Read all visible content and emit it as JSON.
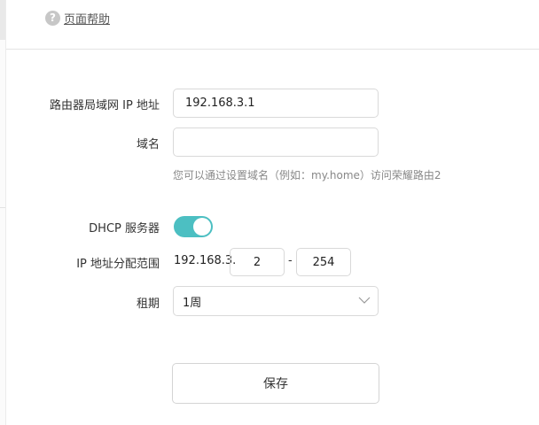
{
  "header": {
    "help_icon": "question-circle-icon",
    "help_label": "页面帮助"
  },
  "form": {
    "lan_ip": {
      "label": "路由器局域网 IP 地址",
      "value": "192.168.3.1"
    },
    "domain": {
      "label": "域名",
      "value": "",
      "hint": "您可以通过设置域名（例如：my.home）访问荣耀路由2"
    },
    "dhcp": {
      "label": "DHCP 服务器",
      "enabled": true
    },
    "ip_range": {
      "label": "IP 地址分配范围",
      "prefix": "192.168.3.",
      "start": "2",
      "separator": "-",
      "end": "254"
    },
    "lease": {
      "label": "租期",
      "value": "1周"
    }
  },
  "actions": {
    "save_label": "保存"
  },
  "colors": {
    "toggle_on": "#4cbfc2",
    "border": "#d9d9d9",
    "hint_text": "#888888"
  }
}
